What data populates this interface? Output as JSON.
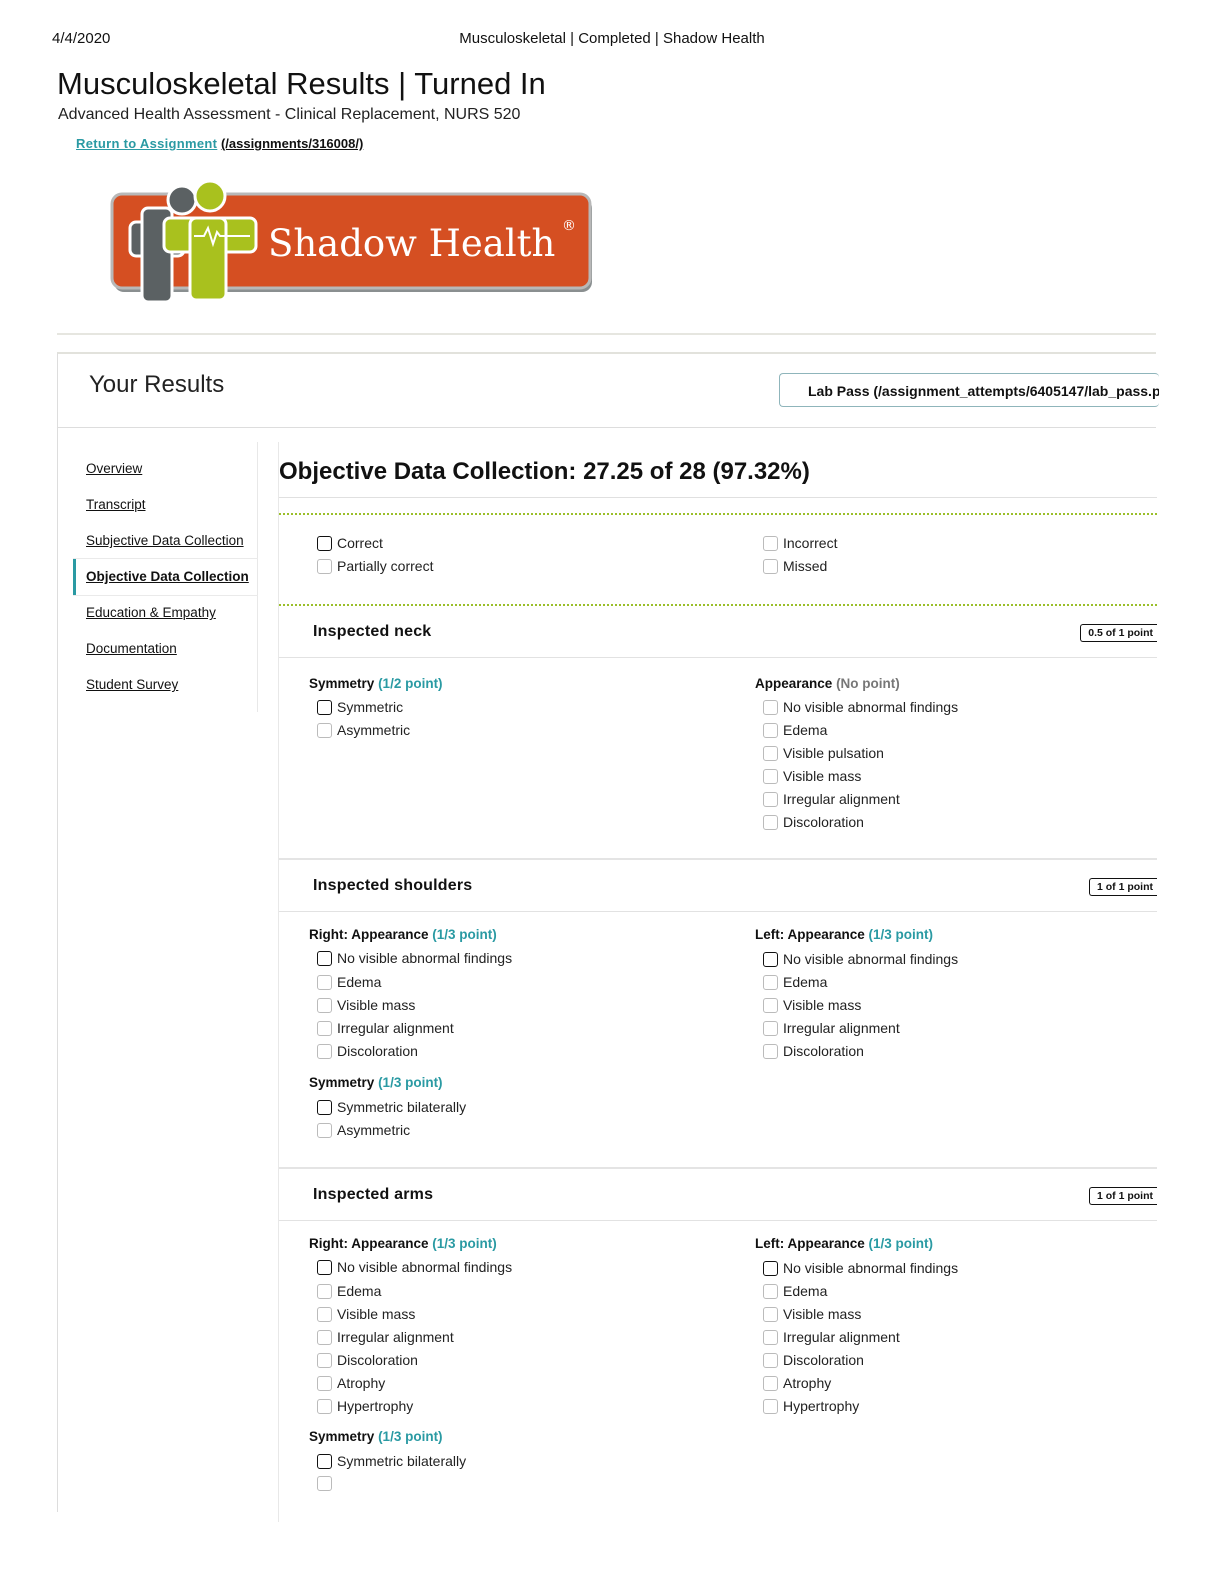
{
  "print_header": {
    "date": "4/4/2020",
    "title": "Musculoskeletal | Completed | Shadow Health"
  },
  "page": {
    "title": "Musculoskeletal Results | Turned In",
    "course": "Advanced Health Assessment - Clinical Replacement, NURS 520",
    "return_label": "Return to Assignment",
    "return_url": "(/assignments/316008/)"
  },
  "logo": {
    "text": "Shadow Health",
    "registered": "®",
    "colors": {
      "orange": "#d54f22",
      "lime": "#a9c11e",
      "gray": "#5b6163"
    }
  },
  "results": {
    "title": "Your Results",
    "lab_pass": "Lab Pass (/assignment_attempts/6405147/lab_pass.p"
  },
  "sidebar": {
    "items": [
      {
        "label": "Overview"
      },
      {
        "label": "Transcript"
      },
      {
        "label": "Subjective Data Collection"
      },
      {
        "label": "Objective Data Collection"
      },
      {
        "label": "Education & Empathy"
      },
      {
        "label": "Documentation"
      },
      {
        "label": "Student Survey"
      }
    ],
    "accent": "#2a9aa3"
  },
  "section": {
    "title": "Objective Data Collection: 27.25 of 28 (97.32%)",
    "legend": [
      "Correct",
      "Incorrect",
      "Partially correct",
      "Missed"
    ]
  },
  "cards": {
    "neck": {
      "title": "Inspected neck",
      "score": "0.5 of 1 point",
      "symmetry": {
        "label": "Symmetry",
        "points": "(1/2 point)",
        "options": [
          "Symmetric",
          "Asymmetric"
        ]
      },
      "appearance": {
        "label": "Appearance",
        "points": "(No point)",
        "options": [
          "No visible abnormal findings",
          "Edema",
          "Visible pulsation",
          "Visible mass",
          "Irregular alignment",
          "Discoloration"
        ]
      }
    },
    "shoulders": {
      "title": "Inspected shoulders",
      "score": "1 of 1 point",
      "right": {
        "label": "Right: Appearance",
        "points": "(1/3 point)",
        "options": [
          "No visible abnormal findings",
          "Edema",
          "Visible mass",
          "Irregular alignment",
          "Discoloration"
        ]
      },
      "left": {
        "label": "Left: Appearance",
        "points": "(1/3 point)",
        "options": [
          "No visible abnormal findings",
          "Edema",
          "Visible mass",
          "Irregular alignment",
          "Discoloration"
        ]
      },
      "symmetry": {
        "label": "Symmetry",
        "points": "(1/3 point)",
        "options": [
          "Symmetric bilaterally",
          "Asymmetric"
        ]
      }
    },
    "arms": {
      "title": "Inspected arms",
      "score": "1 of 1 point",
      "right": {
        "label": "Right: Appearance",
        "points": "(1/3 point)",
        "options": [
          "No visible abnormal findings",
          "Edema",
          "Visible mass",
          "Irregular alignment",
          "Discoloration",
          "Atrophy",
          "Hypertrophy"
        ]
      },
      "left": {
        "label": "Left: Appearance",
        "points": "(1/3 point)",
        "options": [
          "No visible abnormal findings",
          "Edema",
          "Visible mass",
          "Irregular alignment",
          "Discoloration",
          "Atrophy",
          "Hypertrophy"
        ]
      },
      "symmetry": {
        "label": "Symmetry",
        "points": "(1/3 point)",
        "options": [
          "Symmetric bilaterally"
        ]
      }
    }
  }
}
